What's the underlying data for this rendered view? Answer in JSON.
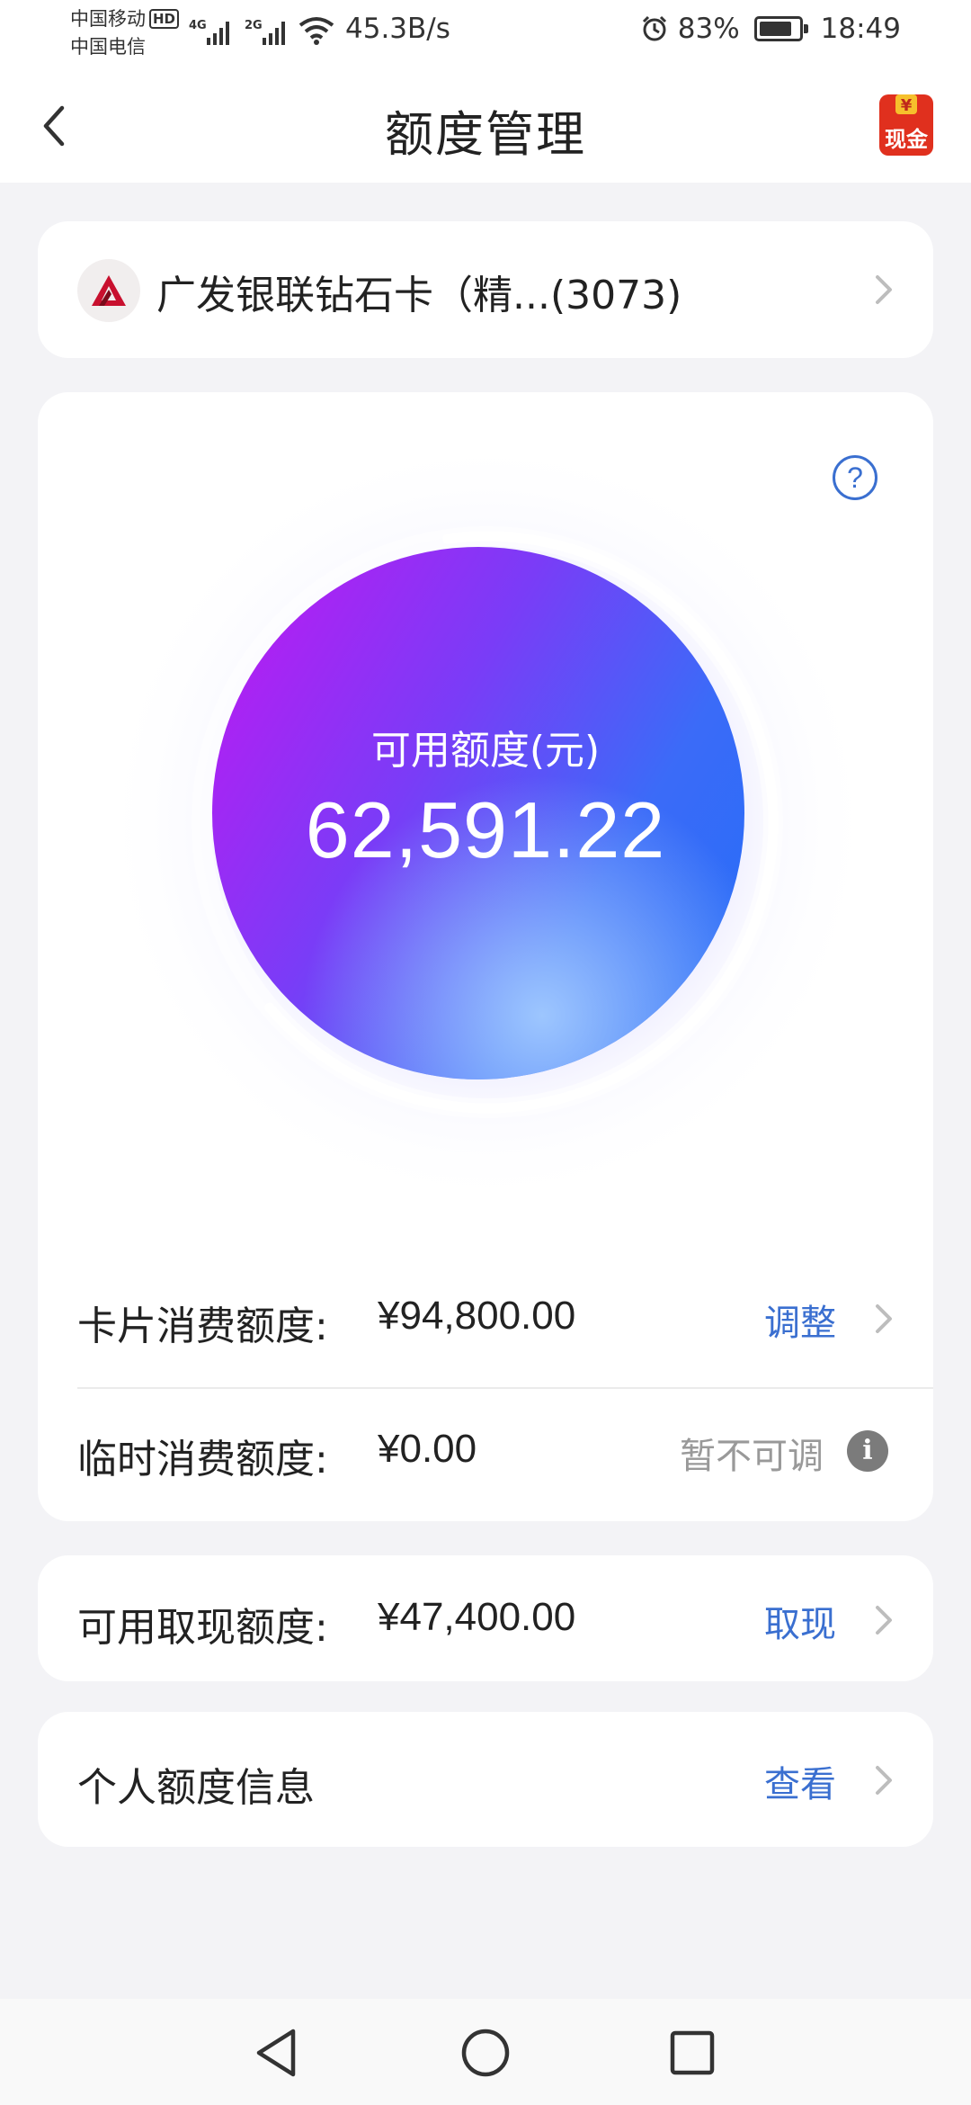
{
  "status_bar": {
    "carrier_1": "中国移动",
    "hd_badge": "HD",
    "carrier_2": "中国电信",
    "signal_1_type": "4G",
    "signal_2_type": "2G",
    "net_speed": "45.3B/s",
    "battery_percent": "83%",
    "battery_level": 0.83,
    "time": "18:49"
  },
  "header": {
    "title": "额度管理",
    "back_icon": "chevron-left-icon",
    "cash_badge_icon": "yen-cash-badge",
    "cash_badge_text": "现金"
  },
  "bank_card": {
    "name": "广发银联钻石卡（精...(3073)",
    "logo_icon": "bank-logo"
  },
  "available_credit": {
    "label": "可用额度(元)",
    "value": "62,591.22",
    "used_fraction": 0.34,
    "help_icon": "question-icon"
  },
  "rows": {
    "card_limit": {
      "label": "卡片消费额度:",
      "value": "¥94,800.00",
      "action": "调整"
    },
    "temp_limit": {
      "label": "临时消费额度:",
      "value": "¥0.00",
      "action": "暂不可调",
      "info_icon": "info-icon"
    },
    "cash_limit": {
      "label": "可用取现额度:",
      "value": "¥47,400.00",
      "action": "取现"
    },
    "personal_info": {
      "label": "个人额度信息",
      "action": "查看"
    }
  },
  "colors": {
    "accent": "#3a6fd0",
    "gauge_start": "#b81cf2",
    "gauge_end": "#2a6cf7",
    "brand_red": "#c8102e"
  },
  "nav": {
    "back": "triangle-back-icon",
    "home": "circle-home-icon",
    "recent": "square-recent-icon"
  }
}
